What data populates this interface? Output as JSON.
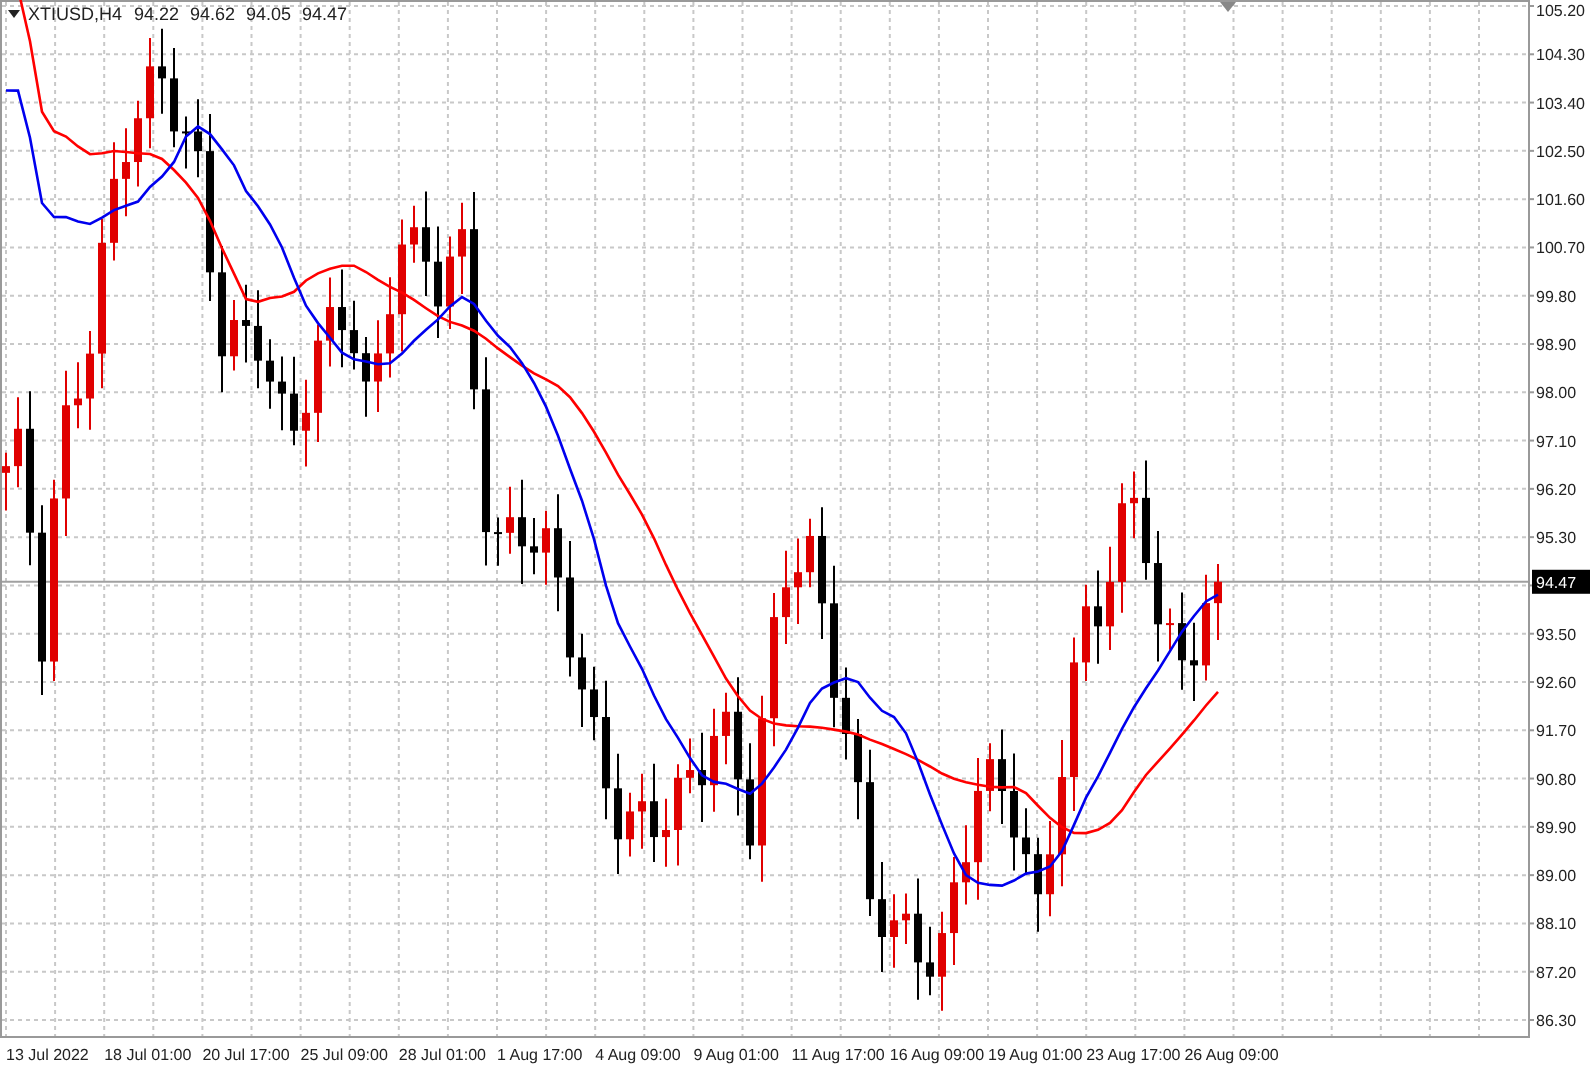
{
  "chart_header": {
    "symbol": "XTIUSD,H4",
    "ohlc": [
      "94.22",
      "94.62",
      "94.05",
      "94.47"
    ]
  },
  "price_axis": {
    "ticks_above": [
      "105.20",
      "104.30",
      "103.40",
      "102.50",
      "101.60",
      "100.70",
      "99.80",
      "98.90",
      "98.00",
      "97.10",
      "96.20",
      "95.30"
    ],
    "current_price": "94.47",
    "ticks_below": [
      "93.50",
      "92.60",
      "91.70",
      "90.80",
      "89.90",
      "89.00",
      "88.10",
      "87.20",
      "86.30"
    ]
  },
  "time_axis": {
    "labels": [
      "13 Jul 2022",
      "18 Jul 01:00",
      "20 Jul 17:00",
      "25 Jul 09:00",
      "28 Jul 01:00",
      "1 Aug 17:00",
      "4 Aug 09:00",
      "9 Aug 01:00",
      "11 Aug 17:00",
      "16 Aug 09:00",
      "19 Aug 01:00",
      "23 Aug 17:00",
      "26 Aug 09:00"
    ]
  }
}
